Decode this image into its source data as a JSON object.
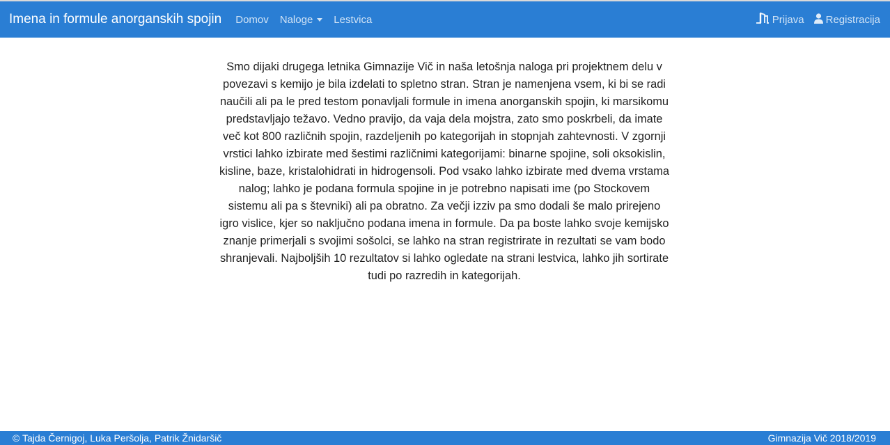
{
  "navbar": {
    "brand": "Imena in formule anorganskih spojin",
    "links": {
      "home": "Domov",
      "tasks": "Naloge",
      "leaderboard": "Lestvica"
    },
    "login": {
      "label": "Prijava",
      "icon": "login-door-icon"
    },
    "register": {
      "label": "Registracija",
      "icon": "user-icon"
    },
    "color": "#2a7ed4"
  },
  "main": {
    "intro": "Smo dijaki drugega letnika Gimnazije Vič in naša letošnja naloga pri projektnem delu v povezavi s kemijo je bila izdelati to spletno stran. Stran je namenjena vsem, ki bi se radi naučili ali pa le pred testom ponavljali formule in imena anorganskih spojin, ki marsikomu predstavljajo težavo. Vedno pravijo, da vaja dela mojstra, zato smo poskrbeli, da imate več kot 800 različnih spojin, razdeljenih po kategorijah in stopnjah zahtevnosti. V zgornji vrstici lahko izbirate med šestimi različnimi kategorijami: binarne spojine, soli oksokislin, kisline, baze, kristalohidrati in hidrogensoli. Pod vsako lahko izbirate med dvema vrstama nalog; lahko je podana formula spojine in je potrebno napisati ime (po Stockovem sistemu ali pa s števniki) ali pa obratno. Za večji izziv pa smo dodali še malo prirejeno igro vislice, kjer so naključno podana imena in formule. Da pa boste lahko svoje kemijsko znanje primerjali s svojimi sošolci, se lahko na stran registrirate in rezultati se vam bodo shranjevali. Najboljših 10 rezultatov si lahko ogledate na strani lestvica, lahko jih sortirate tudi po razredih in kategorijah."
  },
  "footer": {
    "authors": "© Tajda Černigoj, Luka Peršolja, Patrik Žnidaršič",
    "school": "Gimnazija Vič 2018/2019"
  }
}
